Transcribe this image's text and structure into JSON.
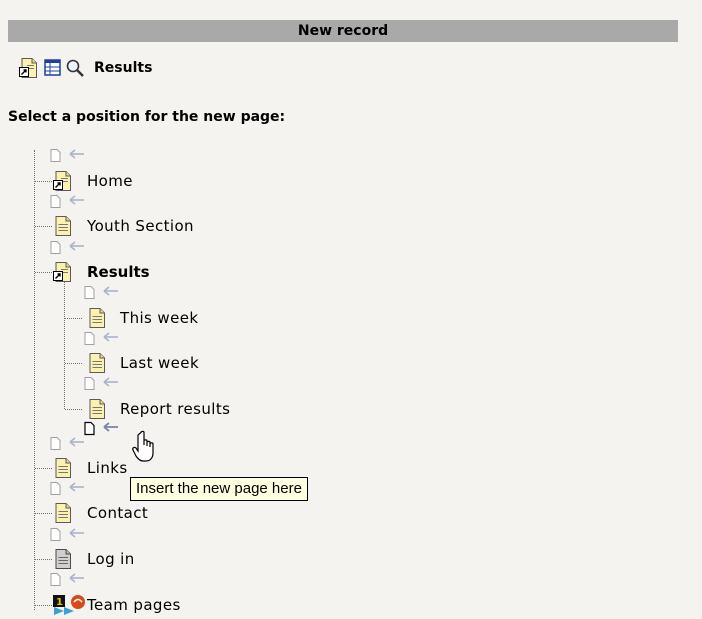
{
  "header": {
    "title": "New record"
  },
  "breadcrumb": {
    "label": "Results"
  },
  "prompt": "Select a position for the new page:",
  "tree": {
    "home": "Home",
    "youth": "Youth Section",
    "results": "Results",
    "this_week": "This week",
    "last_week": "Last week",
    "report": "Report results",
    "links": "Links",
    "contact": "Contact",
    "login": "Log in",
    "team": "Team pages"
  },
  "tooltip": "Insert the new page here",
  "icons": {
    "page": "page-icon",
    "shortcut": "shortcut-page-icon",
    "list": "list-view-icon",
    "search": "magnifier-icon",
    "insert": "insert-position-icon",
    "hidden": "hidden-page-icon",
    "mount": "mount-point-icon",
    "cursor": "hand-cursor-icon"
  }
}
